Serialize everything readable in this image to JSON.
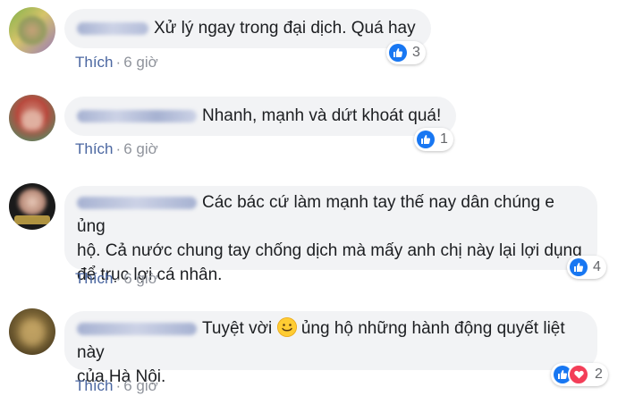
{
  "comments": [
    {
      "text": "Xử lý ngay trong đại dịch. Quá hay",
      "like_label": "Thích",
      "separator": "·",
      "time": "6 giờ",
      "reaction_count": "3"
    },
    {
      "text": "Nhanh, mạnh và dứt khoát quá!",
      "like_label": "Thích",
      "separator": "·",
      "time": "6 giờ",
      "reaction_count": "1"
    },
    {
      "text_line1": "Các bác cứ làm mạnh tay thế nay dân chúng e ủng",
      "text_line2": "hộ. Cả nước chung tay chống dịch mà mấy anh chị này lại lợi dụng",
      "text_line3": "để trục lợi cá nhân.",
      "like_label": "Thích",
      "separator": "·",
      "time": "6 giờ",
      "reaction_count": "4"
    },
    {
      "text_line1a": "Tuyệt vời",
      "text_line1b": "ủng hộ những hành động quyết liệt này",
      "text_line2": "của Hà Nội.",
      "like_label": "Thích",
      "separator": "·",
      "time": "6 giờ",
      "reaction_count": "2"
    }
  ],
  "colors": {
    "bubble": "#f2f3f5",
    "like_blue": "#1877f2",
    "heart_red": "#f33e58",
    "link": "#4b67a1",
    "muted": "#90949c"
  },
  "icons": [
    "like-icon",
    "heart-icon",
    "smile-emoji-icon"
  ]
}
